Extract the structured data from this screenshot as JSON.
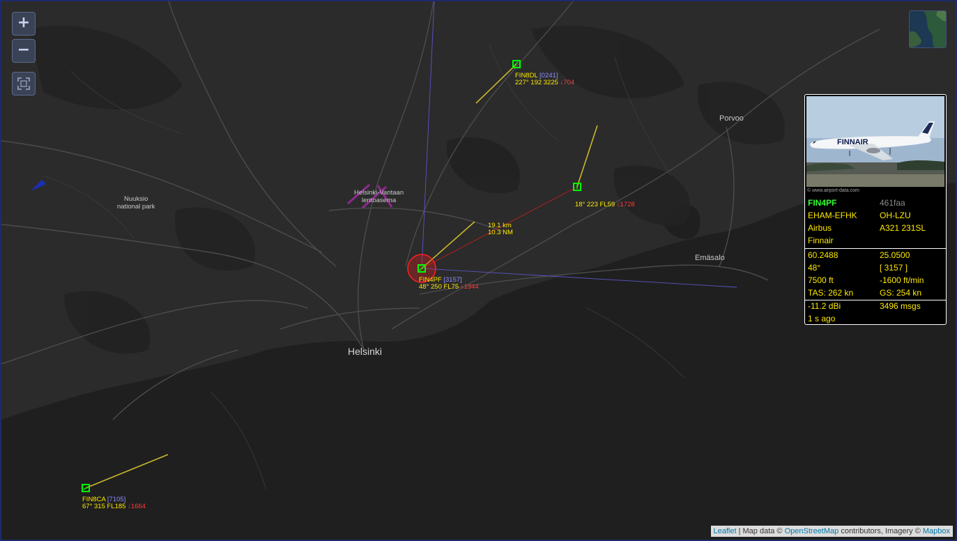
{
  "map": {
    "controls": {
      "zoom_in": "+",
      "zoom_out": "−"
    },
    "place_labels": {
      "helsinki": "Helsinki",
      "porvoo": "Porvoo",
      "emasalo": "Emäsalo",
      "nuuksio_1": "Nuuksio",
      "nuuksio_2": "national park",
      "airport_1": "Helsinki-Vantaan",
      "airport_2": "lentoasema"
    },
    "range": {
      "km": "19.1 km",
      "nm": "10.3 NM"
    },
    "aircraft": [
      {
        "callsign": "FIN4PF",
        "squawk": "3157",
        "data": "48° 250 FL75",
        "vs": "↓1344",
        "selected": true
      },
      {
        "callsign": "FIN8DL",
        "squawk": "0241",
        "data": "227° 192 3225",
        "vs": "↓704"
      },
      {
        "callsign": "",
        "squawk": "",
        "data": "18° 223 FL59",
        "vs": "↓1728"
      },
      {
        "callsign": "FIN8CA",
        "squawk": "7105",
        "data": "67° 315 FL185",
        "vs": "↓1664"
      }
    ],
    "attribution": {
      "leaflet": "Leaflet",
      "sep1": " | Map data © ",
      "osm": "OpenStreetMap",
      "sep2": " contributors, Imagery © ",
      "mapbox": "Mapbox"
    }
  },
  "info_panel": {
    "photo_credit": "© www.airport-data.com",
    "livery_text": "FINNAIR",
    "callsign": "FIN4PF",
    "icao": "461faa",
    "route": "EHAM-EFHK",
    "registration": "OH-LZU",
    "manufacturer": "Airbus",
    "model": "A321 231SL",
    "operator": "Finnair",
    "lat": "60.2488",
    "lon": "25.0500",
    "track": "48°",
    "squawk": "[ 3157 ]",
    "altitude": "7500 ft",
    "vertical_rate": "-1600 ft/min",
    "tas": "TAS: 262 kn",
    "gs": "GS: 254 kn",
    "signal": "-11.2 dBi",
    "messages": "3496 msgs",
    "age": "1 s ago"
  },
  "colors": {
    "aircraft": "#00ff00",
    "text": "#ffea00",
    "vs": "#ff3b3b",
    "squawk": "#8f8fff",
    "selected_ring": "#ff2020",
    "callsign_selected": "#33ff33"
  }
}
